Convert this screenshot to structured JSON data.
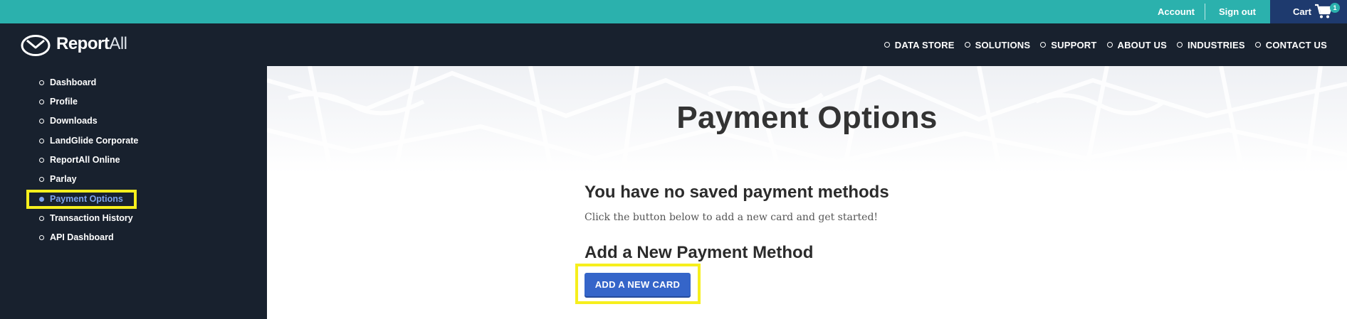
{
  "topbar": {
    "account_label": "Account",
    "signout_label": "Sign out",
    "cart_label": "Cart",
    "cart_count": "1",
    "colors": {
      "bar": "#2bb1ad",
      "cart_box": "#1e3a6e"
    }
  },
  "brand": {
    "name_bold": "Report",
    "name_light": "All",
    "logo_icon": "clock-envelope-icon"
  },
  "nav": {
    "items": [
      {
        "label": "DATA STORE"
      },
      {
        "label": "SOLUTIONS"
      },
      {
        "label": "SUPPORT"
      },
      {
        "label": "ABOUT US"
      },
      {
        "label": "INDUSTRIES"
      },
      {
        "label": "CONTACT US"
      }
    ]
  },
  "sidebar": {
    "items": [
      {
        "label": "Dashboard"
      },
      {
        "label": "Profile"
      },
      {
        "label": "Downloads"
      },
      {
        "label": "LandGlide Corporate"
      },
      {
        "label": "ReportAll Online"
      },
      {
        "label": "Parlay"
      },
      {
        "label": "Payment Options",
        "active": true
      },
      {
        "label": "Transaction History"
      },
      {
        "label": "API Dashboard"
      }
    ],
    "active_color": "#7fa4ee"
  },
  "main": {
    "title": "Payment Options",
    "no_methods_heading": "You have no saved payment methods",
    "no_methods_text": "Click the button below to add a new card and get started!",
    "add_heading": "Add a New Payment Method",
    "add_button_label": "ADD A NEW CARD",
    "highlight_color": "#f6ef1d"
  }
}
